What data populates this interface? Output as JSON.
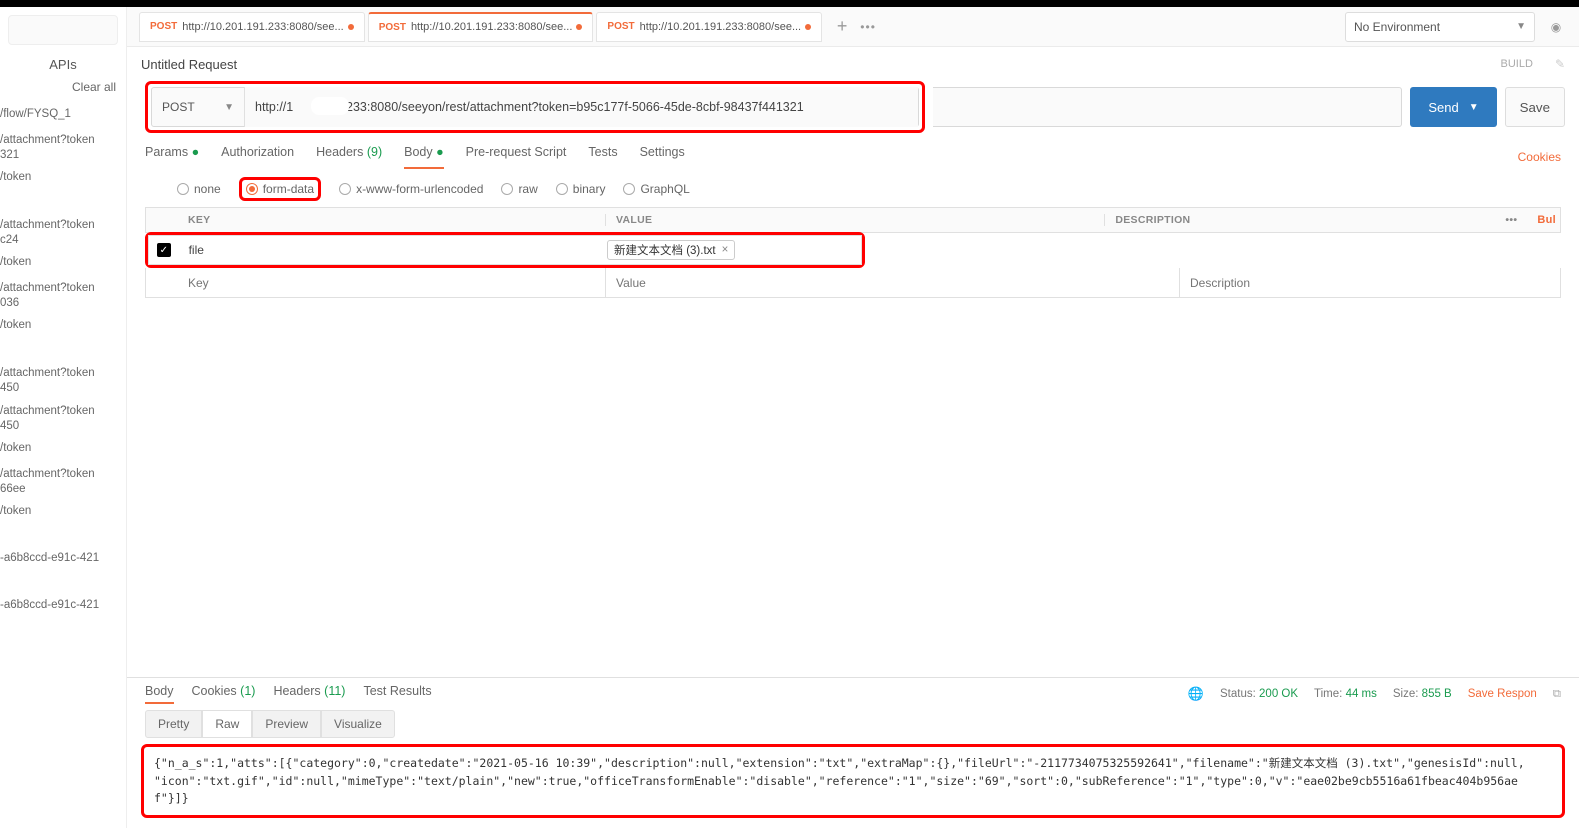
{
  "sidebar": {
    "search_placeholder": "",
    "apis_title": "APIs",
    "clear_all": "Clear all",
    "items": [
      "/flow/FYSQ_1",
      "/attachment?token\n321",
      "/token",
      "/attachment?token\nc24",
      "/token",
      "/attachment?token\n036",
      "/token",
      "/attachment?token\n450",
      "/attachment?token\n450",
      "/token",
      "/attachment?token\n66ee",
      "/token",
      "-a6b8ccd-e91c-421",
      "-a6b8ccd-e91c-421"
    ]
  },
  "tabs": [
    {
      "method": "POST",
      "label": "http://10.201.191.233:8080/see..."
    },
    {
      "method": "POST",
      "label": "http://10.201.191.233:8080/see..."
    },
    {
      "method": "POST",
      "label": "http://10.201.191.233:8080/see..."
    }
  ],
  "env": {
    "label": "No Environment"
  },
  "request": {
    "title": "Untitled Request",
    "build": "BUILD",
    "method": "POST",
    "url_visible": "http://1           )1.233:8080/seeyon/rest/attachment?token=b95c177f-5066-45de-8cbf-98437f441321",
    "send": "Send",
    "save": "Save"
  },
  "subtabs": {
    "params": "Params",
    "auth": "Authorization",
    "headers": "Headers",
    "headers_count": "(9)",
    "body": "Body",
    "prescript": "Pre-request Script",
    "tests": "Tests",
    "settings": "Settings",
    "cookies_link": "Cookies"
  },
  "body_types": {
    "none": "none",
    "formdata": "form-data",
    "urlencoded": "x-www-form-urlencoded",
    "raw": "raw",
    "binary": "binary",
    "graphql": "GraphQL"
  },
  "kv": {
    "head_key": "KEY",
    "head_val": "VALUE",
    "head_desc": "DESCRIPTION",
    "head_more": "•••",
    "bul": "Bul",
    "file_key": "file",
    "file_name": "新建文本文档 (3).txt",
    "ph_key": "Key",
    "ph_val": "Value",
    "ph_desc": "Description"
  },
  "resp_tabs": {
    "body": "Body",
    "cookies": "Cookies",
    "cookies_count": "(1)",
    "headers": "Headers",
    "headers_count": "(11)",
    "tests": "Test Results"
  },
  "resp_meta": {
    "status_label": "Status:",
    "status_val": "200 OK",
    "time_label": "Time:",
    "time_val": "44 ms",
    "size_label": "Size:",
    "size_val": "855 B",
    "save": "Save Respon"
  },
  "resp_views": {
    "pretty": "Pretty",
    "raw": "Raw",
    "preview": "Preview",
    "visualize": "Visualize"
  },
  "response_body": "{\"n_a_s\":1,\"atts\":[{\"category\":0,\"createdate\":\"2021-05-16 10:39\",\"description\":null,\"extension\":\"txt\",\"extraMap\":{},\"fileUrl\":\"-2117734075325592641\",\"filename\":\"新建文本文档 (3).txt\",\"genesisId\":null,\n\"icon\":\"txt.gif\",\"id\":null,\"mimeType\":\"text/plain\",\"new\":true,\"officeTransformEnable\":\"disable\",\"reference\":\"1\",\"size\":\"69\",\"sort\":0,\"subReference\":\"1\",\"type\":0,\"v\":\"eae02be9cb5516a61fbeac404b956aef\"}]}"
}
